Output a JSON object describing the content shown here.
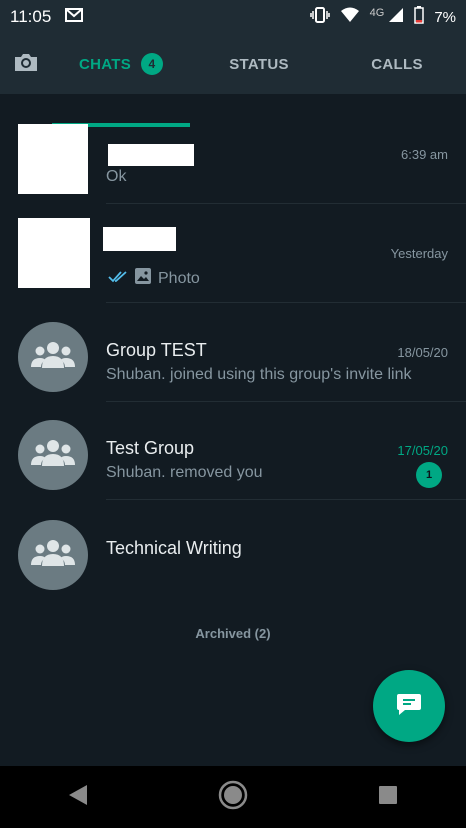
{
  "status_bar": {
    "time": "11:05",
    "network": "4G",
    "battery": "7%"
  },
  "tabs": {
    "camera_icon": "camera-icon",
    "chats_label": "CHATS",
    "chats_badge": "4",
    "status_label": "STATUS",
    "calls_label": "CALLS",
    "active": "CHATS"
  },
  "chats": [
    {
      "name": "",
      "message": "Ok",
      "time": "6:39 am",
      "avatar": "redacted"
    },
    {
      "name": "",
      "message": "Photo",
      "time": "Yesterday",
      "avatar": "redacted",
      "read_receipt": "double-check-icon",
      "media_icon": "image-icon"
    },
    {
      "name": "Group TEST",
      "message": "Shuban. joined using this group's invite link",
      "time": "18/05/20",
      "avatar": "group-icon"
    },
    {
      "name": "Test Group",
      "message": "Shuban. removed you",
      "time": "17/05/20",
      "unread_count": "1",
      "avatar": "group-icon"
    },
    {
      "name": "Technical Writing",
      "message": "",
      "time": "",
      "avatar": "group-icon"
    }
  ],
  "archived_label": "Archived (2)",
  "fab_icon": "new-chat-icon",
  "colors": {
    "accent": "#00a884",
    "background": "#121b22",
    "header": "#1f2c34"
  }
}
